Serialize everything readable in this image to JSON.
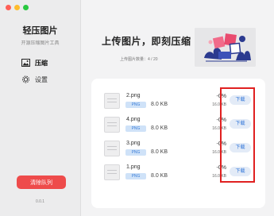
{
  "sidebar": {
    "app_title": "轻压图片",
    "app_subtitle": "开源压缩图片工具",
    "nav": [
      {
        "label": "压缩",
        "icon": "image-icon",
        "active": true
      },
      {
        "label": "设置",
        "icon": "gear-icon",
        "active": false
      }
    ],
    "clear_button": "清除队列",
    "version": "0.0.1"
  },
  "hero": {
    "title": "上传图片，即刻压缩",
    "count_text": "上传图片数量：4 / 20"
  },
  "files": [
    {
      "name": "2.png",
      "format": "PNG",
      "size": "8.0 KB",
      "ratio": "-0%",
      "out_size": "16.0 KB",
      "download": "下载"
    },
    {
      "name": "4.png",
      "format": "PNG",
      "size": "8.0 KB",
      "ratio": "-0%",
      "out_size": "16.0 KB",
      "download": "下载"
    },
    {
      "name": "3.png",
      "format": "PNG",
      "size": "8.0 KB",
      "ratio": "-0%",
      "out_size": "16.0 KB",
      "download": "下载"
    },
    {
      "name": "1.png",
      "format": "PNG",
      "size": "8.0 KB",
      "ratio": "-0%",
      "out_size": "16.0 KB",
      "download": "下载"
    }
  ],
  "colors": {
    "accent_red": "#ee4b4b",
    "download_text": "#2f74d8",
    "badge_bg": "#cfe2f8",
    "highlight": "#e02020"
  }
}
